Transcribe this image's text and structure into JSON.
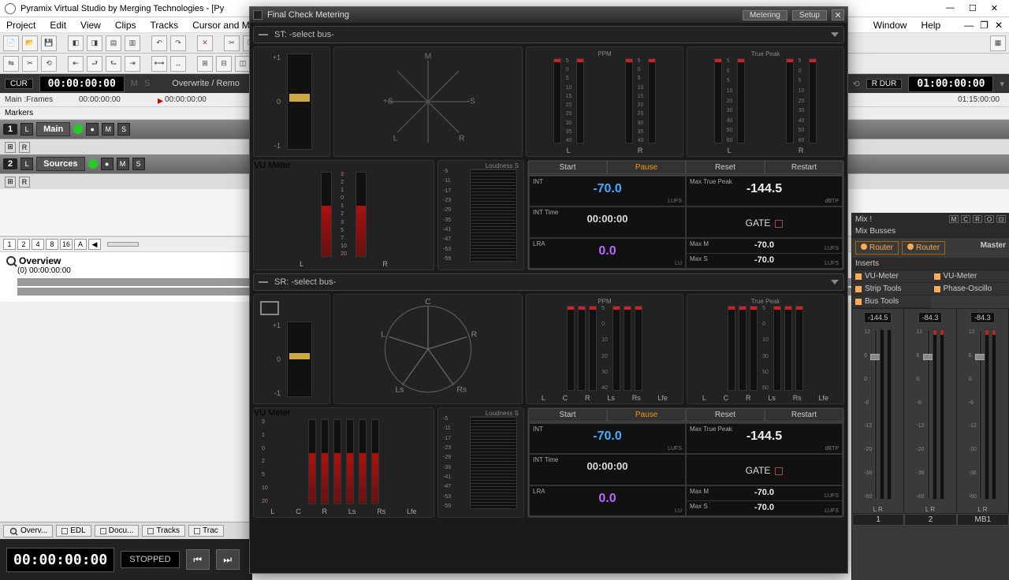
{
  "app": {
    "title": "Pyramix Virtual Studio by Merging Technologies - [Py"
  },
  "menu": {
    "items": [
      "Project",
      "Edit",
      "View",
      "Clips",
      "Tracks",
      "Cursor and M"
    ],
    "right": [
      "Window",
      "Help"
    ]
  },
  "time": {
    "cur_label": "CUR",
    "cur_tc": "00:00:00:00",
    "ms_m": "M",
    "ms_s": "S",
    "mode": "Overwrite / Remo",
    "rdur_label": "R DUR",
    "rdur_tc": "01:00:00:00"
  },
  "rulers": {
    "main_label": "Main :Frames",
    "main_tc": "00:00:00:00",
    "play_tc": "00:00:00:00",
    "right_tc": "01:15:00:00",
    "markers_label": "Markers"
  },
  "tracks": {
    "t1": {
      "num": "1",
      "l": "L",
      "name": "Main",
      "m": "M",
      "s": "S",
      "rec": "●",
      "auto": "●"
    },
    "t2": {
      "num": "2",
      "l": "L",
      "name": "Sources",
      "m": "M",
      "s": "S",
      "rec": "●",
      "auto": "●"
    },
    "sub_r": "R",
    "sub_icon": "⊞"
  },
  "zoom": {
    "buttons": [
      "1",
      "2",
      "4",
      "8",
      "16",
      "A",
      "◀"
    ]
  },
  "overview": {
    "title": "Overview",
    "tc": "(0) 00:00:00:00"
  },
  "bottom_tabs": {
    "items": [
      "Overv...",
      "EDL",
      "Docu...",
      "Tracks",
      "Trac"
    ]
  },
  "transport": {
    "tc": "00:00:00:00",
    "status": "STOPPED"
  },
  "modal": {
    "title": "Final Check Metering",
    "tabs": [
      "Metering",
      "Setup"
    ],
    "bus1_label": "ST: -select bus-",
    "bus2_label": "SR: -select bus-",
    "corr": {
      "ticks": [
        "+1",
        "0",
        "-1"
      ]
    },
    "phase_st": {
      "labels": [
        "M",
        "+S",
        "-S",
        "L",
        "R"
      ]
    },
    "ppm": {
      "title": "PPM",
      "ticks": [
        "5",
        "0",
        "5",
        "10",
        "15",
        "20",
        "25",
        "30",
        "35",
        "40"
      ],
      "ch": [
        "L",
        "R"
      ]
    },
    "tp": {
      "title": "True Peak",
      "ticks": [
        "5",
        "0",
        "5",
        "10",
        "20",
        "30",
        "40",
        "50",
        "60"
      ],
      "ch": [
        "L",
        "R"
      ]
    },
    "vu": {
      "title": "VU Meter",
      "ticks": [
        "3",
        "2",
        "1",
        "0",
        "1",
        "2",
        "3",
        "5",
        "7",
        "10",
        "20"
      ],
      "ch": [
        "L",
        "R"
      ]
    },
    "loud": {
      "title": "Loudness   S",
      "ticks": [
        "-5",
        "-11",
        "-17",
        "-23",
        "-29",
        "-35",
        "-41",
        "-47",
        "-53",
        "-59"
      ]
    },
    "stats": {
      "buttons": [
        "Start",
        "Pause",
        "Reset",
        "Restart"
      ],
      "int_label": "INT",
      "int_val": "-70.0",
      "int_unit": "LUFS",
      "mtp_label": "Max True Peak",
      "mtp_val": "-144.5",
      "mtp_unit": "dBTP",
      "itime_label": "INT Time",
      "itime_val": "00:00:00",
      "gate_label": "GATE",
      "lra_label": "LRA",
      "lra_val": "0.0",
      "lra_unit": "LU",
      "maxm_label": "Max M",
      "maxm_val": "-70.0",
      "maxm_unit": "LUFS",
      "maxs_label": "Max S",
      "maxs_val": "-70.0",
      "maxs_unit": "LUFS"
    },
    "sr_channels": [
      "L",
      "C",
      "R",
      "Ls",
      "Rs",
      "Lfe"
    ],
    "surround_labels": [
      "C",
      "R",
      "Rs",
      "Ls",
      "L"
    ]
  },
  "mix": {
    "title": "Mix !",
    "hdr_btns": [
      "M",
      "C",
      "R",
      "O",
      "⊡"
    ],
    "busses_label": "Mix Busses",
    "router": "Router",
    "master": "Master",
    "inserts_label": "Inserts",
    "inserts": [
      "VU-Meter",
      "Strip Tools",
      "Bus Tools"
    ],
    "inserts_right": [
      "VU-Meter",
      "Phase-Oscillo"
    ],
    "peaks": [
      "-144.5",
      "-84.3",
      "-84.3"
    ],
    "fader_ticks": [
      "12",
      "6",
      "0",
      "-6",
      "-12",
      "-20",
      "-36",
      "-60"
    ],
    "lr": "L R",
    "nums": [
      "1",
      "2",
      "MB1"
    ],
    "chart_icon": "og"
  }
}
